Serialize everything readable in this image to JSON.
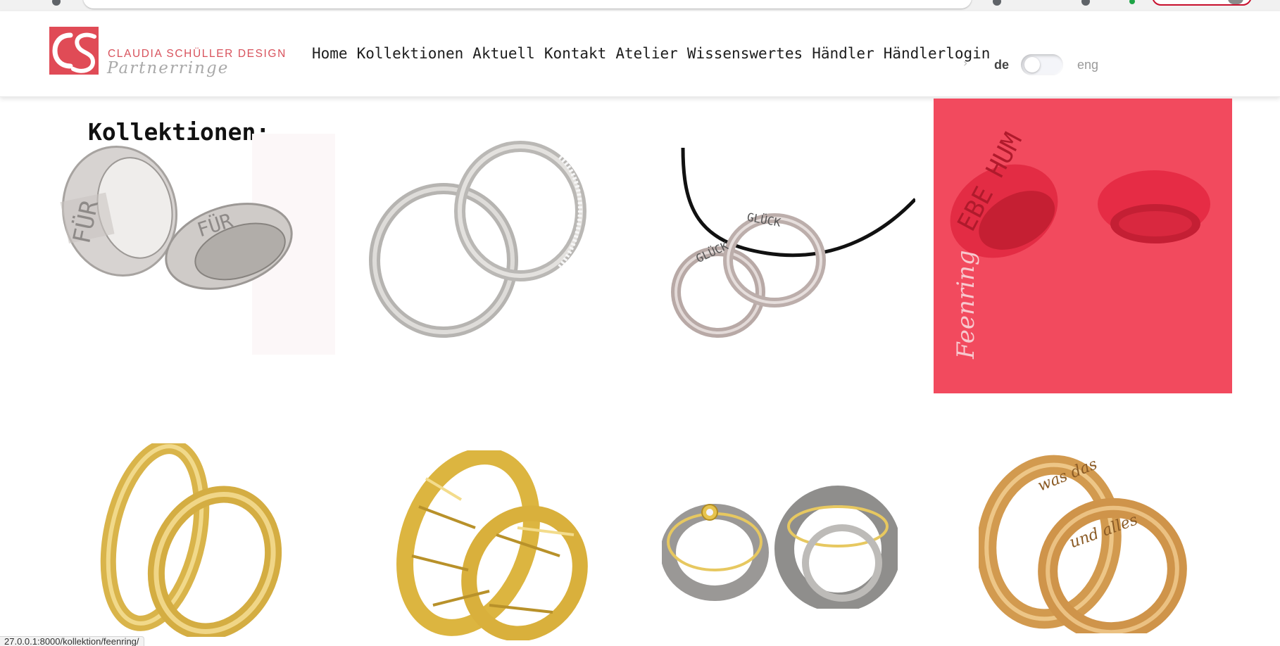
{
  "site": {
    "brand_name": "CLAUDIA SCHÜLLER DESIGN",
    "brand_sub": "Partnerringe",
    "accent_color": "#e04b56"
  },
  "nav": {
    "items": [
      {
        "label": "Home"
      },
      {
        "label": "Kollektionen"
      },
      {
        "label": "Aktuell"
      },
      {
        "label": "Kontakt"
      },
      {
        "label": "Atelier"
      },
      {
        "label": "Wissenswertes"
      },
      {
        "label": "Händler"
      },
      {
        "label": "Händlerlogin"
      }
    ],
    "overflow_icon": "chevron-right-icon"
  },
  "language": {
    "de": "de",
    "eng": "eng",
    "selected": "de"
  },
  "main": {
    "title": "Kollektionen:",
    "collections": [
      {
        "name": "silver-engraved-rings"
      },
      {
        "name": "interlocked-silver-rings"
      },
      {
        "name": "glueck-pendant-rings"
      },
      {
        "name": "feenring",
        "label": "Feenring",
        "highlight_color": "#f24a5e"
      },
      {
        "name": "gold-stacked-rings"
      },
      {
        "name": "gold-textured-rings"
      },
      {
        "name": "bicolor-rings"
      },
      {
        "name": "rose-gold-engraved-rings"
      }
    ]
  },
  "status_bar": {
    "url": "27.0.0.1:8000/kollektion/feenring/"
  }
}
